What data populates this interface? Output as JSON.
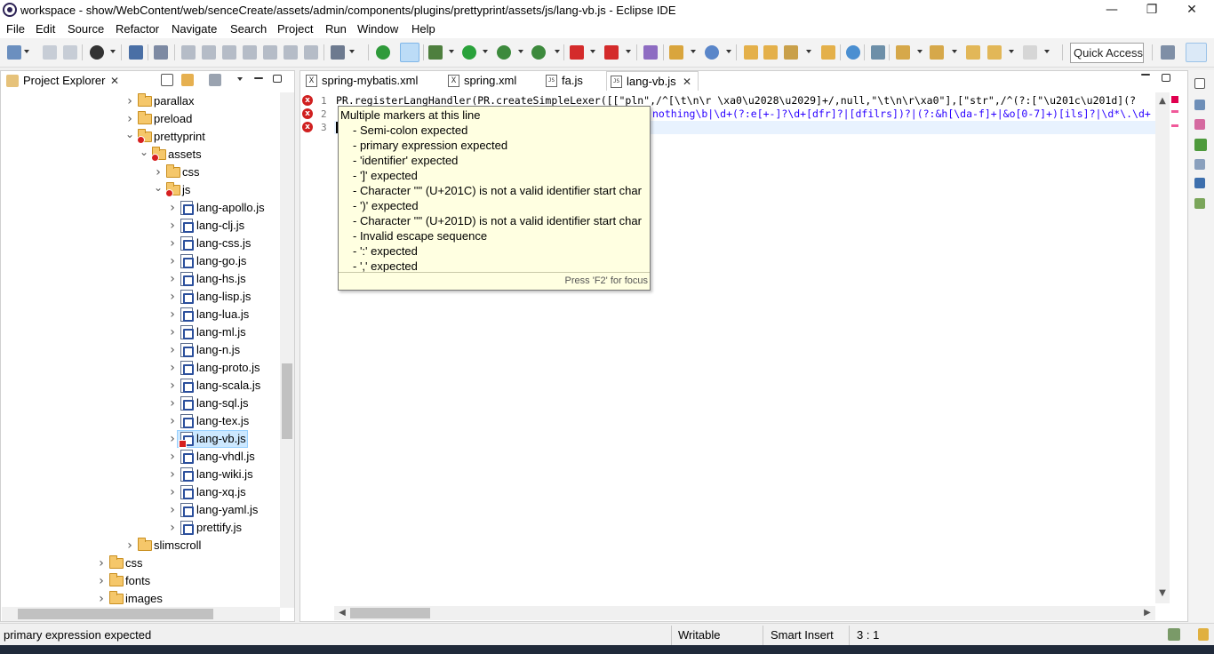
{
  "window": {
    "title": "workspace - show/WebContent/web/senceCreate/assets/admin/components/plugins/prettyprint/assets/js/lang-vb.js - Eclipse IDE",
    "minimize": "—",
    "restore": "❐",
    "close": "✕"
  },
  "menu": [
    "File",
    "Edit",
    "Source",
    "Refactor",
    "Navigate",
    "Search",
    "Project",
    "Run",
    "Window",
    "Help"
  ],
  "toolbar": {
    "quick_access": "Quick Access"
  },
  "explorer": {
    "title": "Project Explorer",
    "close": "✕",
    "items": [
      {
        "label": "parallax",
        "type": "folder",
        "depth": 0,
        "expanded": false
      },
      {
        "label": "preload",
        "type": "folder",
        "depth": 0,
        "expanded": false
      },
      {
        "label": "prettyprint",
        "type": "folder-err",
        "depth": 0,
        "expanded": true
      },
      {
        "label": "assets",
        "type": "folder-err",
        "depth": 1,
        "expanded": true
      },
      {
        "label": "css",
        "type": "folder",
        "depth": 2,
        "expanded": false
      },
      {
        "label": "js",
        "type": "folder-err",
        "depth": 2,
        "expanded": true
      },
      {
        "label": "lang-apollo.js",
        "type": "js",
        "depth": 3
      },
      {
        "label": "lang-clj.js",
        "type": "js",
        "depth": 3
      },
      {
        "label": "lang-css.js",
        "type": "js",
        "depth": 3
      },
      {
        "label": "lang-go.js",
        "type": "js",
        "depth": 3
      },
      {
        "label": "lang-hs.js",
        "type": "js",
        "depth": 3
      },
      {
        "label": "lang-lisp.js",
        "type": "js",
        "depth": 3
      },
      {
        "label": "lang-lua.js",
        "type": "js",
        "depth": 3
      },
      {
        "label": "lang-ml.js",
        "type": "js",
        "depth": 3
      },
      {
        "label": "lang-n.js",
        "type": "js",
        "depth": 3
      },
      {
        "label": "lang-proto.js",
        "type": "js",
        "depth": 3
      },
      {
        "label": "lang-scala.js",
        "type": "js",
        "depth": 3
      },
      {
        "label": "lang-sql.js",
        "type": "js",
        "depth": 3
      },
      {
        "label": "lang-tex.js",
        "type": "js",
        "depth": 3
      },
      {
        "label": "lang-vb.js",
        "type": "js-err",
        "depth": 3,
        "selected": true
      },
      {
        "label": "lang-vhdl.js",
        "type": "js",
        "depth": 3
      },
      {
        "label": "lang-wiki.js",
        "type": "js",
        "depth": 3
      },
      {
        "label": "lang-xq.js",
        "type": "js",
        "depth": 3
      },
      {
        "label": "lang-yaml.js",
        "type": "js",
        "depth": 3
      },
      {
        "label": "prettify.js",
        "type": "js",
        "depth": 3
      },
      {
        "label": "slimscroll",
        "type": "folder",
        "depth": 0,
        "expanded": false
      },
      {
        "label": "css",
        "type": "folder",
        "depth": -1,
        "expanded": false
      },
      {
        "label": "fonts",
        "type": "folder",
        "depth": -1,
        "expanded": false
      },
      {
        "label": "images",
        "type": "folder",
        "depth": -1,
        "expanded": false
      }
    ]
  },
  "editor": {
    "tabs": [
      {
        "label": "spring-mybatis.xml",
        "icon": "X",
        "active": false
      },
      {
        "label": "spring.xml",
        "icon": "X",
        "active": false
      },
      {
        "label": "fa.js",
        "icon": "JS",
        "active": false
      },
      {
        "label": "lang-vb.js",
        "icon": "JS",
        "active": true
      }
    ],
    "tab_close": "✕",
    "line_numbers": [
      "1",
      "2",
      "3"
    ],
    "line1": "PR.registerLangHandler(PR.createSimpleLexer([[\"pln\",/^[\\t\\n\\r \\xa0\\u2028\\u2029]+/,null,\"\\t\\n\\r\\xa0\"],[\"str\",/^(?:[\"\\u201c\\u201d](?",
    "line2": "nothing\\b|\\d+(?:e[+-]?\\d+[dfr]?|[dfilrs])?|(?:&h[\\da-f]+|&o[0-7]+)[ils]?|\\d*\\.\\d+"
  },
  "popup": {
    "header": "Multiple markers at this line",
    "items": [
      "- Semi-colon expected",
      "- primary expression expected",
      "- 'identifier' expected",
      "- ']' expected",
      "- Character '\"' (U+201C) is not a valid identifier start char",
      "- ')' expected",
      "- Character '\"' (U+201D) is not a valid identifier start char",
      "- Invalid escape sequence",
      "- ':' expected",
      "- ',' expected"
    ],
    "footer": "Press 'F2' for focus"
  },
  "status": {
    "message": "primary expression expected",
    "writable": "Writable",
    "insert_mode": "Smart Insert",
    "position": "3 : 1"
  },
  "colors": {
    "error": "#d02020",
    "selection": "#cce8ff",
    "popup_bg": "#ffffe1"
  }
}
